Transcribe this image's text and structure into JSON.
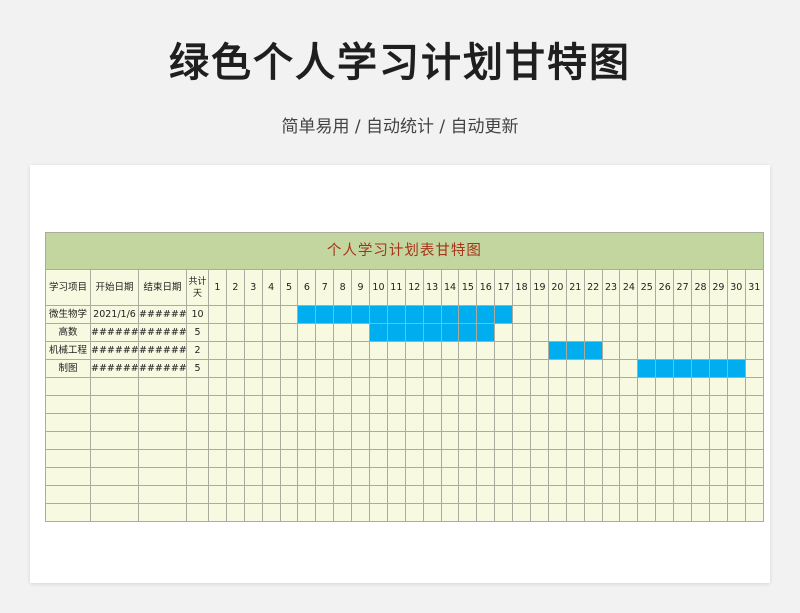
{
  "page": {
    "title": "绿色个人学习计划甘特图",
    "subtitle": "简单易用  /  自动统计  /  自动更新"
  },
  "sheet": {
    "title": "个人学习计划表甘特图",
    "columns": {
      "item": "学习项目",
      "start": "开始日期",
      "end": "结束日期",
      "total": "共计天"
    },
    "days": [
      "1",
      "2",
      "3",
      "4",
      "5",
      "6",
      "7",
      "8",
      "9",
      "10",
      "11",
      "12",
      "13",
      "14",
      "15",
      "16",
      "17",
      "18",
      "19",
      "20",
      "21",
      "22",
      "23",
      "24",
      "25",
      "26",
      "27",
      "28",
      "29",
      "30",
      "31"
    ],
    "rows": [
      {
        "item": "微生物学",
        "start": "2021/1/6",
        "end": "########",
        "total": "10",
        "bar_start_day": 6,
        "bar_days": 12
      },
      {
        "item": "高数",
        "start": "########",
        "end": "########",
        "total": "5",
        "bar_start_day": 10,
        "bar_days": 7
      },
      {
        "item": "机械工程",
        "start": "########",
        "end": "########",
        "total": "2",
        "bar_start_day": 20,
        "bar_days": 3
      },
      {
        "item": "制图",
        "start": "########",
        "end": "########",
        "total": "5",
        "bar_start_day": 25,
        "bar_days": 6
      }
    ],
    "empty_rows": 8,
    "bar_color": "#00aeef",
    "header_color": "#c4d69f",
    "cell_color": "#f7fae0"
  }
}
